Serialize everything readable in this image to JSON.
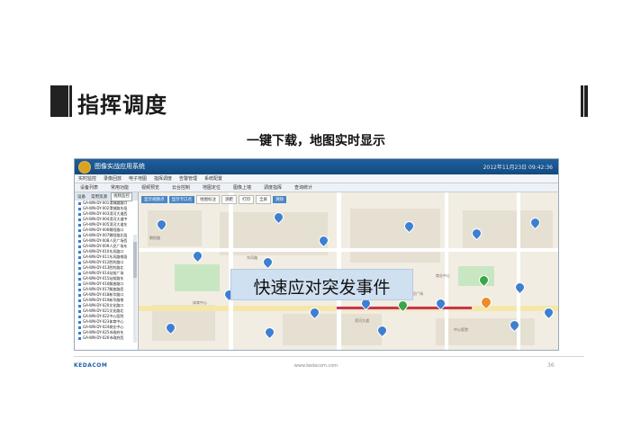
{
  "slide": {
    "title": "指挥调度",
    "subtitle": "一键下载，地图实时显示",
    "callout": "快速应对突发事件"
  },
  "app": {
    "title": "图像实战应用系统",
    "clock": "2012年11月23日 09:42:36",
    "menu": [
      "实时监控",
      "录像回放",
      "电子地图",
      "指挥调度",
      "告警管理",
      "系统配置"
    ],
    "toolbar": [
      "设备列表",
      "常用功能",
      "视频预览",
      "云台控制",
      "地图定位",
      "图像上墙",
      "调度指挥",
      "查询统计"
    ],
    "sidebar_tabs": [
      "设备",
      "常用资源",
      "视频监控"
    ],
    "map_tools": [
      "显示视频点",
      "显示卡口点",
      "地图标注",
      "测距",
      "打印",
      "全屏",
      "清除"
    ],
    "tree_items": [
      "GA-WN-DY-001渭城路路口",
      "GA-WN-DY-002渭城路东段",
      "GA-WN-DY-003滨河大道西",
      "GA-WN-DY-004滨河大道中",
      "GA-WN-DY-005滨河大道东",
      "GA-WN-DY-006朝阳路口",
      "GA-WN-DY-007朝阳路北段",
      "GA-WN-DY-008人民广场西",
      "GA-WN-DY-009人民广场东",
      "GA-WN-DY-010东风路口",
      "GA-WN-DY-011东风路南段",
      "GA-WN-DY-012胜利路口",
      "GA-WN-DY-013胜利路北",
      "GA-WN-DY-014站前广场",
      "GA-WN-DY-015站前路东",
      "GA-WN-DY-016解放路口",
      "GA-WN-DY-017解放路西",
      "GA-WN-DY-018新华路口",
      "GA-WN-DY-019新华路南",
      "GA-WN-DY-020文化路口",
      "GA-WN-DY-021文化路北",
      "GA-WN-DY-022中心医院",
      "GA-WN-DY-023体育中心",
      "GA-WN-DY-024商业中心",
      "GA-WN-DY-025市政府东",
      "GA-WN-DY-026市政府西"
    ],
    "map_labels": [
      "人民广场",
      "商业中心",
      "东风路",
      "朝阳路",
      "体育中心",
      "滨河大道",
      "中心医院"
    ]
  },
  "footer": {
    "logo": "KEDACOM",
    "url": "www.kedacom.com",
    "page": "36"
  },
  "colors": {
    "title_bar": "#1f5f9c",
    "route": "#c03565",
    "pin_blue": "#3d7fd1",
    "pin_orange": "#ef8b2c",
    "callout_bg": "#cfe0f1"
  }
}
